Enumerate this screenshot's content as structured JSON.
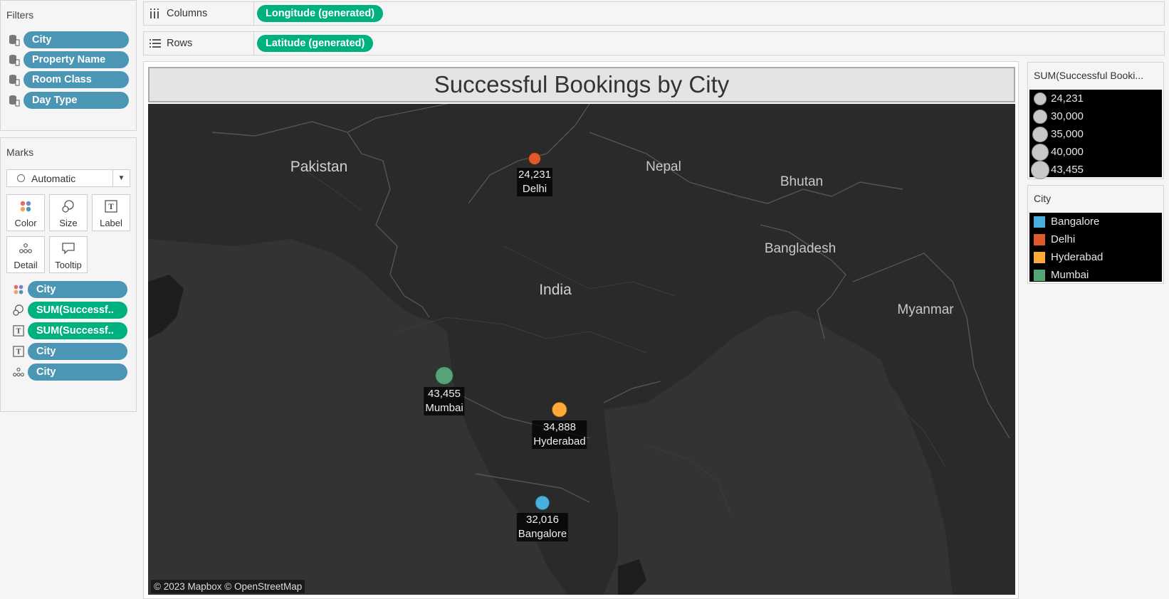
{
  "filters": {
    "title": "Filters",
    "items": [
      "City",
      "Property Name",
      "Room Class",
      "Day Type"
    ]
  },
  "marks": {
    "title": "Marks",
    "mark_type": "Automatic",
    "buttons": {
      "color": "Color",
      "size": "Size",
      "label": "Label",
      "detail": "Detail",
      "tooltip": "Tooltip"
    },
    "fields": [
      {
        "encoding": "color",
        "label": "City",
        "kind": "dimension"
      },
      {
        "encoding": "size",
        "label": "SUM(Successf..",
        "kind": "measure"
      },
      {
        "encoding": "label",
        "label": "SUM(Successf..",
        "kind": "measure"
      },
      {
        "encoding": "label",
        "label": "City",
        "kind": "dimension"
      },
      {
        "encoding": "detail",
        "label": "City",
        "kind": "dimension"
      }
    ]
  },
  "shelves": {
    "columns_label": "Columns",
    "columns_pill": "Longitude (generated)",
    "rows_label": "Rows",
    "rows_pill": "Latitude (generated)"
  },
  "worksheet": {
    "title": "Successful Bookings by City",
    "attribution": "© 2023 Mapbox © OpenStreetMap",
    "country_labels": [
      "Pakistan",
      "Nepal",
      "Bhutan",
      "Bangladesh",
      "India",
      "Myanmar"
    ]
  },
  "size_legend": {
    "title": "SUM(Successful Booki...",
    "entries": [
      "24,231",
      "30,000",
      "35,000",
      "40,000",
      "43,455"
    ]
  },
  "color_legend": {
    "title": "City",
    "entries": [
      {
        "label": "Bangalore",
        "color": "#4bafdc"
      },
      {
        "label": "Delhi",
        "color": "#e05a2b"
      },
      {
        "label": "Hyderabad",
        "color": "#ffa93a"
      },
      {
        "label": "Mumbai",
        "color": "#55a474"
      }
    ]
  },
  "chart_data": {
    "type": "scatter",
    "title": "Successful Bookings by City",
    "points": [
      {
        "city": "Delhi",
        "value": 24231,
        "value_label": "24,231",
        "color": "#e05a2b"
      },
      {
        "city": "Mumbai",
        "value": 43455,
        "value_label": "43,455",
        "color": "#55a474"
      },
      {
        "city": "Hyderabad",
        "value": 34888,
        "value_label": "34,888",
        "color": "#ffa93a"
      },
      {
        "city": "Bangalore",
        "value": 32016,
        "value_label": "32,016",
        "color": "#4bafdc"
      }
    ]
  }
}
